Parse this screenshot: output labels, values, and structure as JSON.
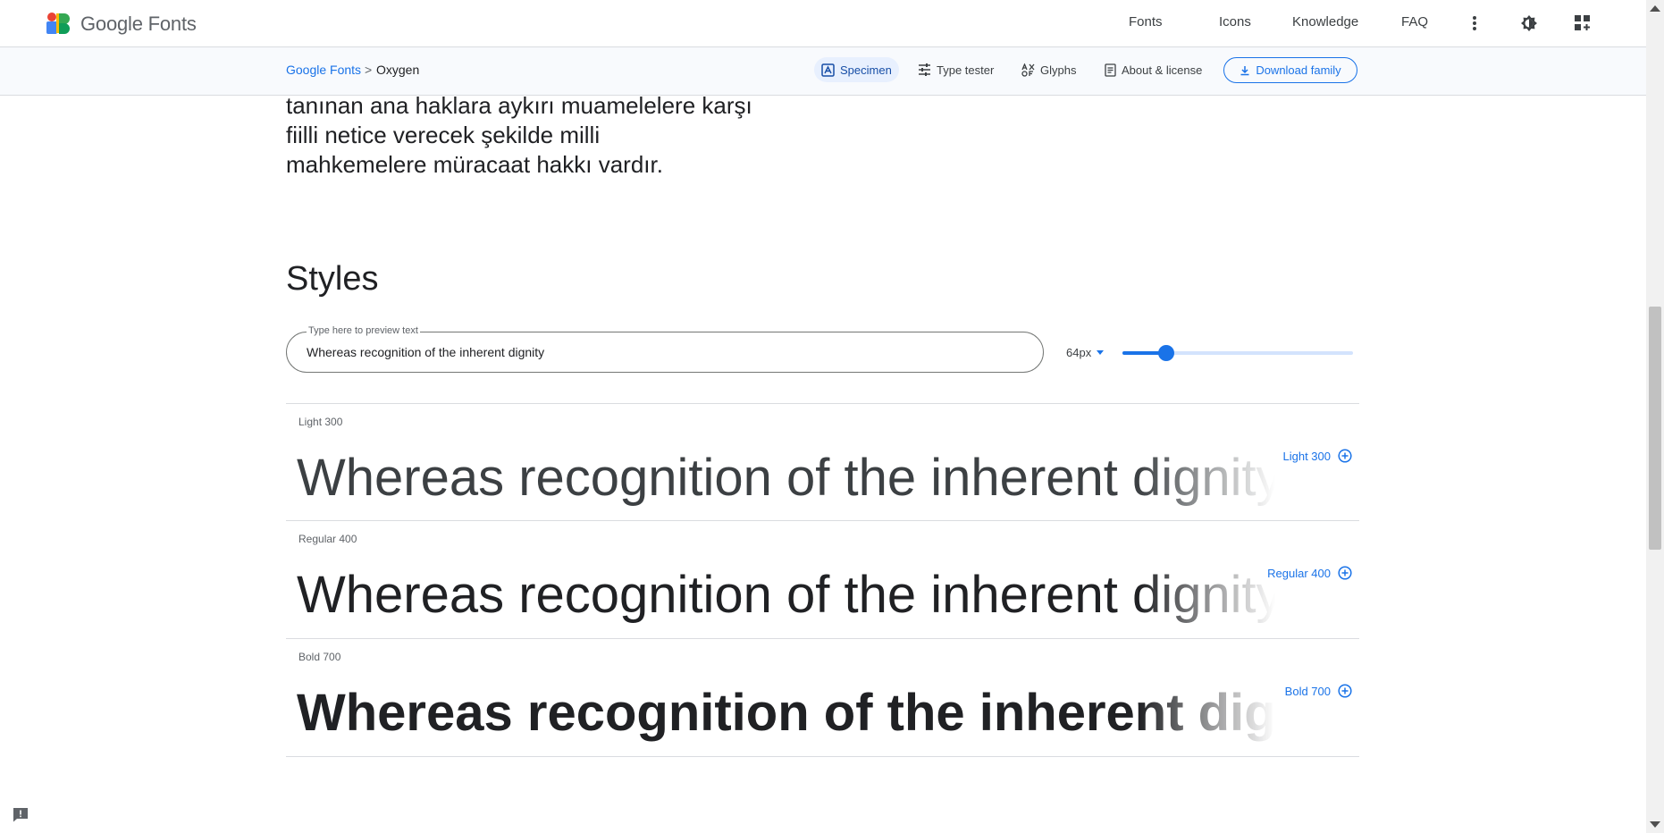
{
  "header": {
    "brand": "Google Fonts",
    "nav": [
      "Fonts",
      "Icons",
      "Knowledge",
      "FAQ"
    ],
    "icons": [
      "more-vert-icon",
      "theme-toggle-icon",
      "apps-icon"
    ]
  },
  "subbar": {
    "breadcrumb_root": "Google Fonts",
    "breadcrumb_sep": ">",
    "breadcrumb_current": "Oxygen",
    "tabs": [
      "Specimen",
      "Type tester",
      "Glyphs",
      "About & license"
    ],
    "active_tab": "Specimen",
    "download_label": "Download family"
  },
  "paragraph": [
    "tanınan ana haklara aykırı muamelelere karşı",
    "fiilli netice verecek şekilde milli",
    "mahkemelere müracaat hakkı vardır."
  ],
  "styles": {
    "heading": "Styles",
    "preview_label": "Type here to preview text",
    "preview_value": "Whereas recognition of the inherent dignity",
    "size_label": "64px",
    "size_slider_fraction": 0.19,
    "rows": [
      {
        "label": "Light 300",
        "add_label": "Light 300",
        "sample": "Whereas recognition of the inherent dignity"
      },
      {
        "label": "Regular 400",
        "add_label": "Regular 400",
        "sample": "Whereas recognition of the inherent dignity"
      },
      {
        "label": "Bold 700",
        "add_label": "Bold 700",
        "sample": "Whereas recognition of the inherent dignity"
      }
    ]
  },
  "colors": {
    "accent": "#1a73e8",
    "active_tab_bg": "#e8f0fe",
    "divider": "#dadce0"
  }
}
